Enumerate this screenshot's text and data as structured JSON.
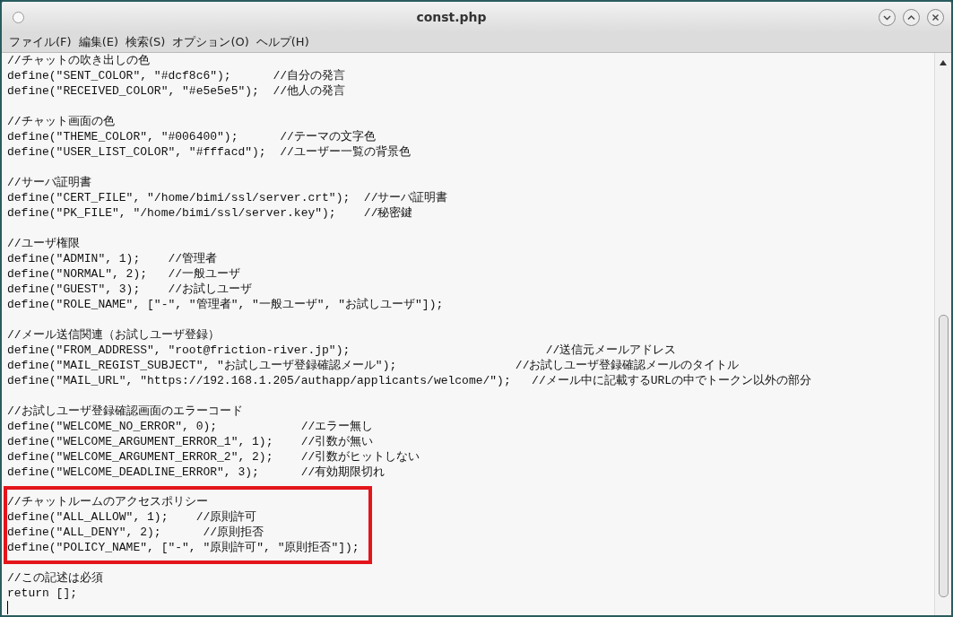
{
  "window": {
    "title": "const.php"
  },
  "menu": [
    "ファイル(F)",
    "編集(E)",
    "検索(S)",
    "オプション(O)",
    "ヘルプ(H)"
  ],
  "editor": {
    "caret_on_last_line": true,
    "sections": [
      {
        "highlighted": false,
        "lines": [
          "//チャットの吹き出しの色",
          "define(\"SENT_COLOR\", \"#dcf8c6\");      //自分の発言",
          "define(\"RECEIVED_COLOR\", \"#e5e5e5\");  //他人の発言"
        ]
      },
      {
        "highlighted": false,
        "lines": [
          "//チャット画面の色",
          "define(\"THEME_COLOR\", \"#006400\");      //テーマの文字色",
          "define(\"USER_LIST_COLOR\", \"#fffacd\");  //ユーザー一覧の背景色"
        ]
      },
      {
        "highlighted": false,
        "lines": [
          "//サーバ証明書",
          "define(\"CERT_FILE\", \"/home/bimi/ssl/server.crt\");  //サーバ証明書",
          "define(\"PK_FILE\", \"/home/bimi/ssl/server.key\");    //秘密鍵"
        ]
      },
      {
        "highlighted": false,
        "lines": [
          "//ユーザ権限",
          "define(\"ADMIN\", 1);    //管理者",
          "define(\"NORMAL\", 2);   //一般ユーザ",
          "define(\"GUEST\", 3);    //お試しユーザ",
          "define(\"ROLE_NAME\", [\"-\", \"管理者\", \"一般ユーザ\", \"お試しユーザ\"]);"
        ]
      },
      {
        "highlighted": false,
        "lines": [
          "//メール送信関連（お試しユーザ登録）",
          "define(\"FROM_ADDRESS\", \"root@friction-river.jp\");                            //送信元メールアドレス",
          "define(\"MAIL_REGIST_SUBJECT\", \"お試しユーザ登録確認メール\");                 //お試しユーザ登録確認メールのタイトル",
          "define(\"MAIL_URL\", \"https://192.168.1.205/authapp/applicants/welcome/\");   //メール中に記載するURLの中でトークン以外の部分"
        ]
      },
      {
        "highlighted": false,
        "lines": [
          "//お試しユーザ登録確認画面のエラーコード",
          "define(\"WELCOME_NO_ERROR\", 0);            //エラー無し",
          "define(\"WELCOME_ARGUMENT_ERROR_1\", 1);    //引数が無い",
          "define(\"WELCOME_ARGUMENT_ERROR_2\", 2);    //引数がヒットしない",
          "define(\"WELCOME_DEADLINE_ERROR\", 3);      //有効期限切れ"
        ]
      },
      {
        "highlighted": true,
        "lines": [
          "//チャットルームのアクセスポリシー",
          "define(\"ALL_ALLOW\", 1);    //原則許可",
          "define(\"ALL_DENY\", 2);      //原則拒否",
          "define(\"POLICY_NAME\", [\"-\", \"原則許可\", \"原則拒否\"]);"
        ]
      },
      {
        "highlighted": false,
        "lines": [
          "//この記述は必須",
          "return [];"
        ]
      }
    ]
  }
}
